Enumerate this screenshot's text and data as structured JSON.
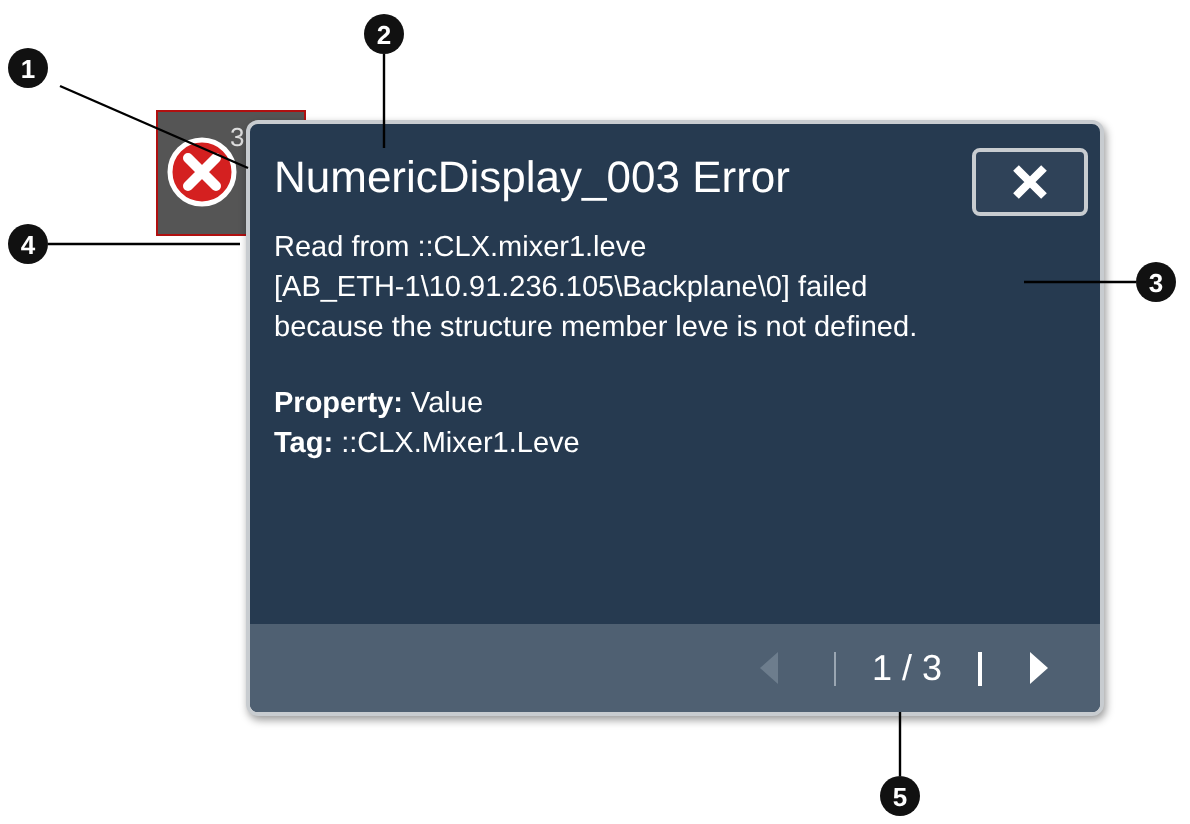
{
  "widget": {
    "value": "3",
    "error": true
  },
  "popup": {
    "title": "NumericDisplay_003 Error",
    "message_lines": [
      "Read from ::CLX.mixer1.leve",
      "[AB_ETH-1\\10.91.236.105\\Backplane\\0] failed",
      "because the structure member leve is not defined."
    ],
    "properties": [
      {
        "label": "Property:",
        "value": "Value"
      },
      {
        "label": "Tag:",
        "value": "::CLX.Mixer1.Leve"
      }
    ],
    "pager": {
      "page": "1 / 3",
      "previous_disabled": true,
      "next_disabled": false
    }
  },
  "callouts": [
    {
      "number": "1"
    },
    {
      "number": "2"
    },
    {
      "number": "3"
    },
    {
      "number": "4"
    },
    {
      "number": "5"
    }
  ]
}
